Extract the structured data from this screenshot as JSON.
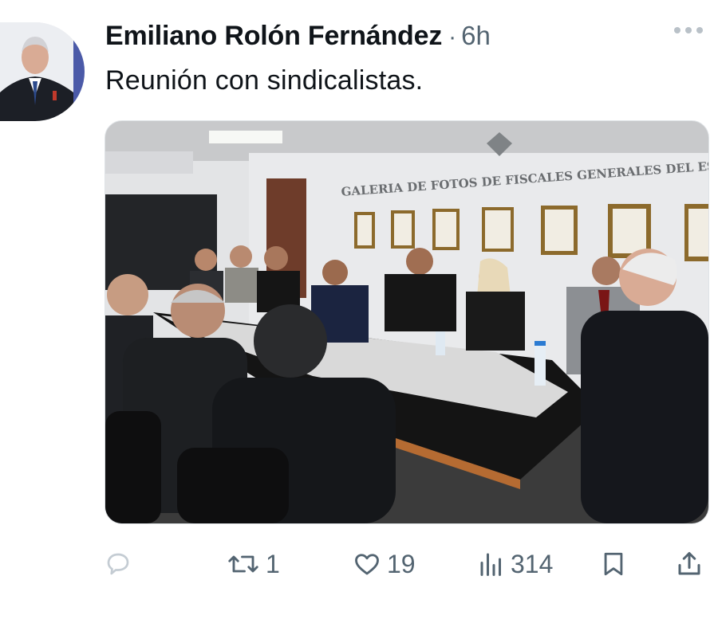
{
  "post": {
    "author_name": "Emiliano Rolón Fernández",
    "separator": "·",
    "time_ago": "6h",
    "text": "Reunión con sindicalistas."
  },
  "media": {
    "wall_sign": "GALERIA DE FOTOS DE FISCALES GENERALES DEL ES"
  },
  "actions": {
    "retweets": "1",
    "likes": "19",
    "views": "314"
  },
  "icons": [
    "more-icon",
    "reply-icon",
    "retweet-icon",
    "like-icon",
    "views-icon",
    "bookmark-icon",
    "share-icon"
  ],
  "colors": {
    "text": "#0f1419",
    "secondary": "#536471",
    "icon_muted": "#b9c1c8"
  }
}
